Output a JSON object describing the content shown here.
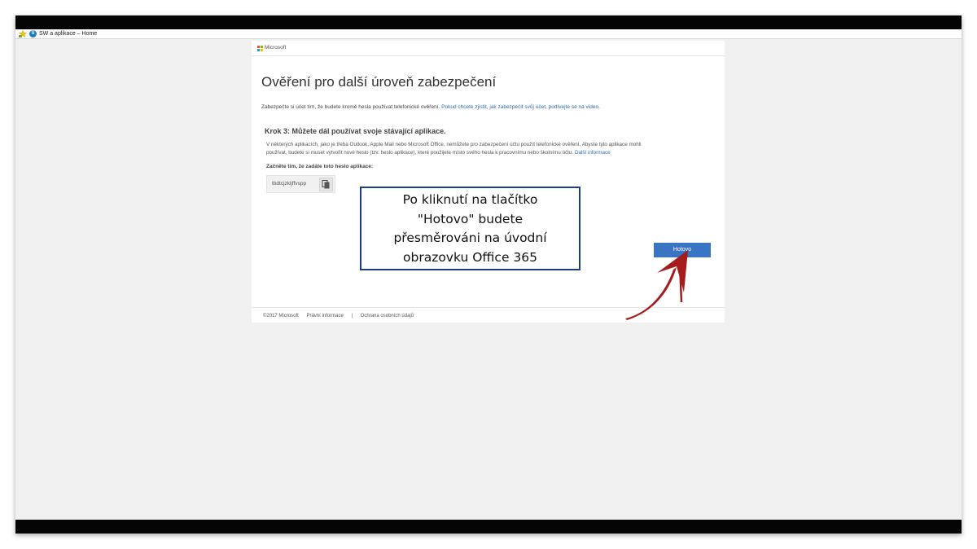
{
  "browser": {
    "favorites_label": "SW a aplikace – Home"
  },
  "header": {
    "brand": "Microsoft"
  },
  "main": {
    "title": "Ověření pro další úroveň zabezpečení",
    "intro_text": "Zabezpečte si účet tím, že budete kromě hesla používat telefonické ověření. ",
    "intro_link": "Pokud chcete zjistit, jak zabezpečit svůj účet, podívejte se na video.",
    "step_title": "Krok 3: Můžete dál používat svoje stávající aplikace.",
    "step_desc_line1": "V některých aplikacích, jako je třeba Outlook, Apple Mail nebo Microsoft Office, nemůžete pro zabezpečení účtu použít telefonické ověření. Abyste tyto aplikace mohli",
    "step_desc_line2": "používat, budete si muset vytvořit nové heslo (tzv. heslo aplikace), které použijete místo svého hesla k pracovnímu nebo školnímu účtu. ",
    "step_desc_link": "Další informace",
    "start_label": "Začněte tím, že zadáte toto heslo aplikace:",
    "app_password": "tbdtcjzkljffvspp",
    "done_label": "Hotovo"
  },
  "footer": {
    "copyright": "©2017 Microsoft",
    "legal": "Právní informace",
    "separator": "|",
    "privacy": "Ochrana osobních údajů"
  },
  "annotation": {
    "lines": [
      "Po kliknutí na tlačítko",
      "\"Hotovo\" budete",
      "přesměrováni na úvodní",
      "obrazovku Office 365"
    ],
    "arrow_color": "#a61c1c",
    "border_color": "#1c3f83"
  },
  "colors": {
    "accent": "#3a74c4",
    "link": "#2a6ab8"
  }
}
